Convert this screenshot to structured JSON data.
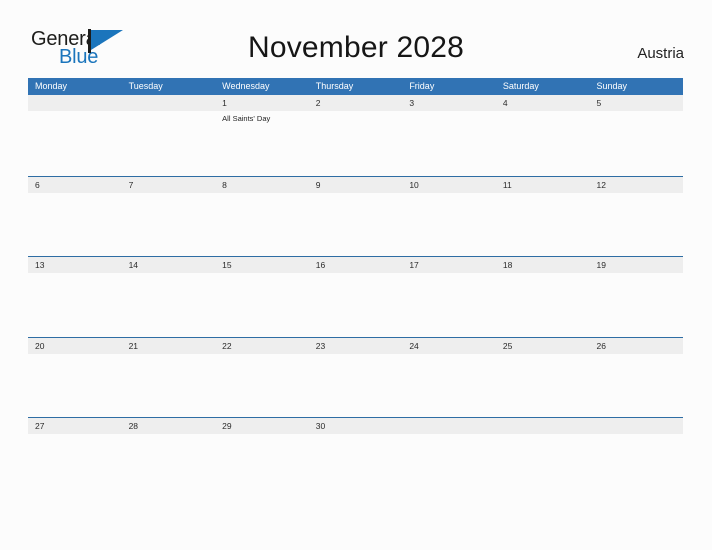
{
  "brand": {
    "name_part1": "General",
    "name_part2": "Blue",
    "mark": "flag-triangle"
  },
  "header": {
    "title": "November 2028",
    "country": "Austria"
  },
  "colors": {
    "header_blue": "#3173b4",
    "row_line_blue": "#2e6da4",
    "band_gray": "#eeeeee",
    "logo_blue": "#1b75bc",
    "page_background": "#fcfcfc"
  },
  "calendar": {
    "weekdays": [
      "Monday",
      "Tuesday",
      "Wednesday",
      "Thursday",
      "Friday",
      "Saturday",
      "Sunday"
    ],
    "weeks": [
      [
        {
          "day": "",
          "events": []
        },
        {
          "day": "",
          "events": []
        },
        {
          "day": "1",
          "events": [
            "All Saints' Day"
          ]
        },
        {
          "day": "2",
          "events": []
        },
        {
          "day": "3",
          "events": []
        },
        {
          "day": "4",
          "events": []
        },
        {
          "day": "5",
          "events": []
        }
      ],
      [
        {
          "day": "6",
          "events": []
        },
        {
          "day": "7",
          "events": []
        },
        {
          "day": "8",
          "events": []
        },
        {
          "day": "9",
          "events": []
        },
        {
          "day": "10",
          "events": []
        },
        {
          "day": "11",
          "events": []
        },
        {
          "day": "12",
          "events": []
        }
      ],
      [
        {
          "day": "13",
          "events": []
        },
        {
          "day": "14",
          "events": []
        },
        {
          "day": "15",
          "events": []
        },
        {
          "day": "16",
          "events": []
        },
        {
          "day": "17",
          "events": []
        },
        {
          "day": "18",
          "events": []
        },
        {
          "day": "19",
          "events": []
        }
      ],
      [
        {
          "day": "20",
          "events": []
        },
        {
          "day": "21",
          "events": []
        },
        {
          "day": "22",
          "events": []
        },
        {
          "day": "23",
          "events": []
        },
        {
          "day": "24",
          "events": []
        },
        {
          "day": "25",
          "events": []
        },
        {
          "day": "26",
          "events": []
        }
      ],
      [
        {
          "day": "27",
          "events": []
        },
        {
          "day": "28",
          "events": []
        },
        {
          "day": "29",
          "events": []
        },
        {
          "day": "30",
          "events": []
        },
        {
          "day": "",
          "events": []
        },
        {
          "day": "",
          "events": []
        },
        {
          "day": "",
          "events": []
        }
      ]
    ]
  }
}
